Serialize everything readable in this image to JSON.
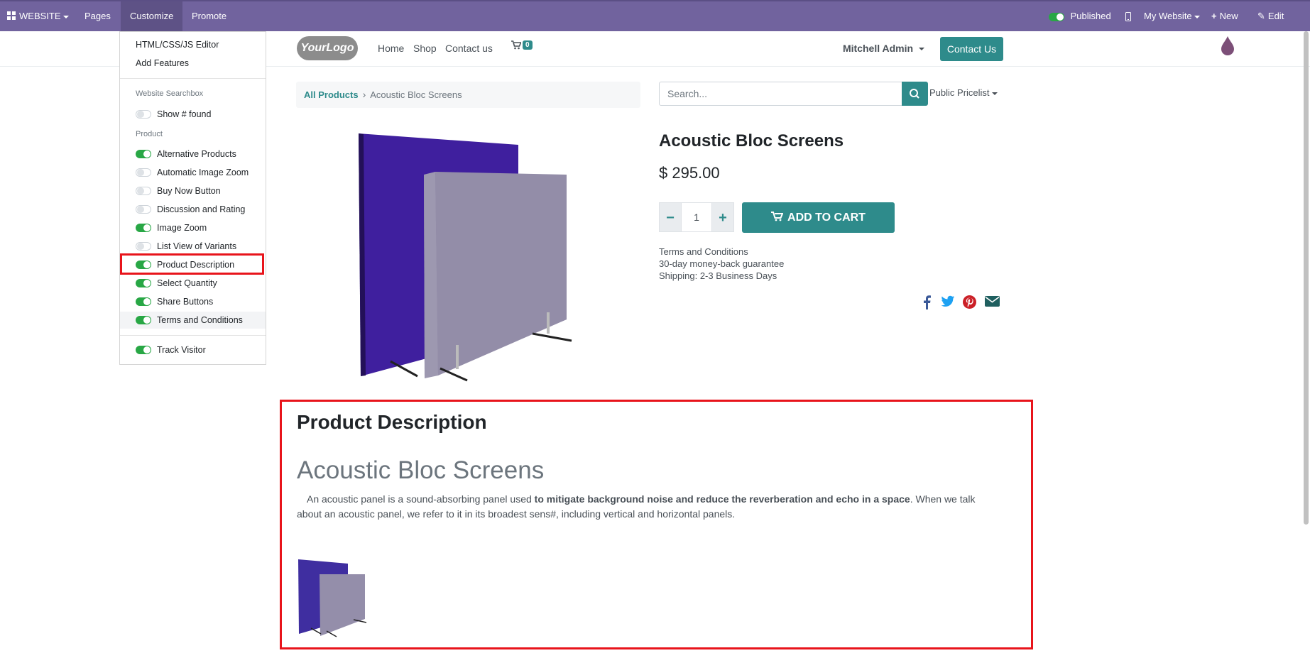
{
  "topbar": {
    "website_label": "WEBSITE",
    "pages_label": "Pages",
    "customize_label": "Customize",
    "promote_label": "Promote",
    "published_label": "Published",
    "my_website_label": "My Website",
    "new_label": "New",
    "edit_label": "Edit"
  },
  "customize_menu": {
    "html_editor": "HTML/CSS/JS Editor",
    "add_features": "Add Features",
    "section_searchbox": "Website Searchbox",
    "show_found": {
      "label": "Show # found",
      "on": false
    },
    "section_product": "Product",
    "toggles": [
      {
        "label": "Alternative Products",
        "on": true
      },
      {
        "label": "Automatic Image Zoom",
        "on": false
      },
      {
        "label": "Buy Now Button",
        "on": false
      },
      {
        "label": "Discussion and Rating",
        "on": false
      },
      {
        "label": "Image Zoom",
        "on": true
      },
      {
        "label": "List View of Variants",
        "on": false
      },
      {
        "label": "Product Description",
        "on": true
      },
      {
        "label": "Select Quantity",
        "on": true
      },
      {
        "label": "Share Buttons",
        "on": true
      },
      {
        "label": "Terms and Conditions",
        "on": true
      }
    ],
    "track_visitor": {
      "label": "Track Visitor",
      "on": true
    }
  },
  "header": {
    "logo_text": "YourLogo",
    "nav": [
      "Home",
      "Shop",
      "Contact us"
    ],
    "cart_count": "0",
    "user": "Mitchell Admin",
    "contact_button": "Contact Us"
  },
  "breadcrumb": {
    "root": "All Products",
    "current": "Acoustic Bloc Screens"
  },
  "search": {
    "placeholder": "Search...",
    "pricelist": "Public Pricelist"
  },
  "product": {
    "name": "Acoustic Bloc Screens",
    "price": "$ 295.00",
    "quantity": "1",
    "add_to_cart": "ADD TO CART",
    "terms": [
      "Terms and Conditions",
      "30-day money-back guarantee",
      "Shipping: 2-3 Business Days"
    ]
  },
  "description": {
    "heading": "Product Description",
    "title": "Acoustic Bloc Screens",
    "text_before": "An acoustic panel is a sound-absorbing panel used ",
    "text_bold": "to mitigate background noise and reduce the reverberation and echo in a space",
    "text_after": ". When we talk about an acoustic panel, we refer to it in its broadest sens#, including vertical and horizontal panels."
  },
  "colors": {
    "topbar": "#71639e",
    "accent": "#2e8b8b",
    "toggle_on": "#28a745",
    "highlight": "#e8141b"
  }
}
